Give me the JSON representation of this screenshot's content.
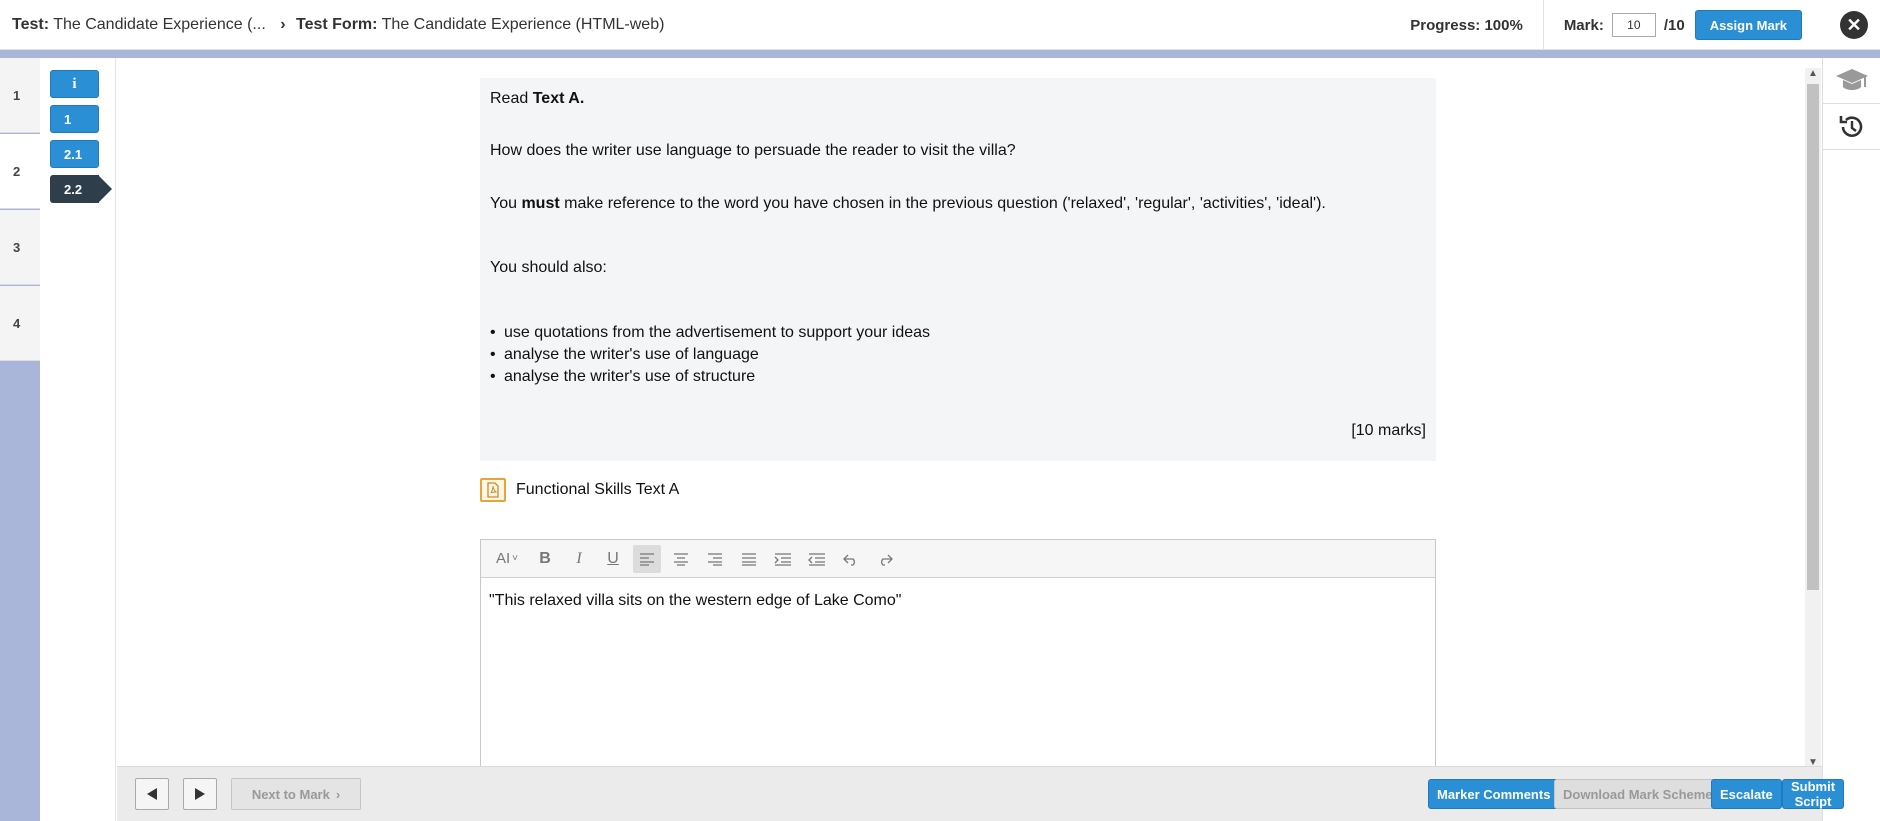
{
  "header": {
    "test_label": "Test:",
    "test_value": "The Candidate Experience (...",
    "form_label": "Test Form:",
    "form_value": "The Candidate Experience (HTML-web)",
    "progress": "Progress: 100%",
    "mark_label": "Mark:",
    "mark_value": "10",
    "mark_total": "/10",
    "assign_label": "Assign Mark",
    "close_icon": "close-icon"
  },
  "sections": [
    "1",
    "2",
    "3",
    "4"
  ],
  "active_section": "2",
  "questions": [
    {
      "label": "i",
      "state": "info"
    },
    {
      "label": "1",
      "state": "done"
    },
    {
      "label": "2.1",
      "state": "done"
    },
    {
      "label": "2.2",
      "state": "current"
    }
  ],
  "question": {
    "read_prefix": "Read ",
    "read_bold": "Text A.",
    "prompt": "How does the writer use language to persuade the reader to visit the villa?",
    "must_prefix": "You ",
    "must_bold": "must",
    "must_suffix": " make reference to the word you have chosen in the previous question ('relaxed', 'regular', 'activities', 'ideal').",
    "should_also": "You should also:",
    "bullets": [
      "use quotations from the advertisement to support your ideas",
      "analyse the writer's use of language",
      "analyse the writer's use of structure"
    ],
    "marks": "[10 marks]"
  },
  "attachment": {
    "label": "Functional Skills Text A",
    "icon": "pdf-icon"
  },
  "editor": {
    "font_size_label": "AI",
    "answer": "\"This relaxed villa sits on the western edge of Lake Como\""
  },
  "footer": {
    "next_to_mark": "Next to Mark",
    "marker_comments": "Marker Comments",
    "download_mark_scheme": "Download Mark Scheme",
    "escalate": "Escalate",
    "submit_script": "Submit Script"
  },
  "colors": {
    "accent": "#2a8fd4",
    "current_question": "#2f3e4b",
    "rail": "#a9b5d9"
  }
}
